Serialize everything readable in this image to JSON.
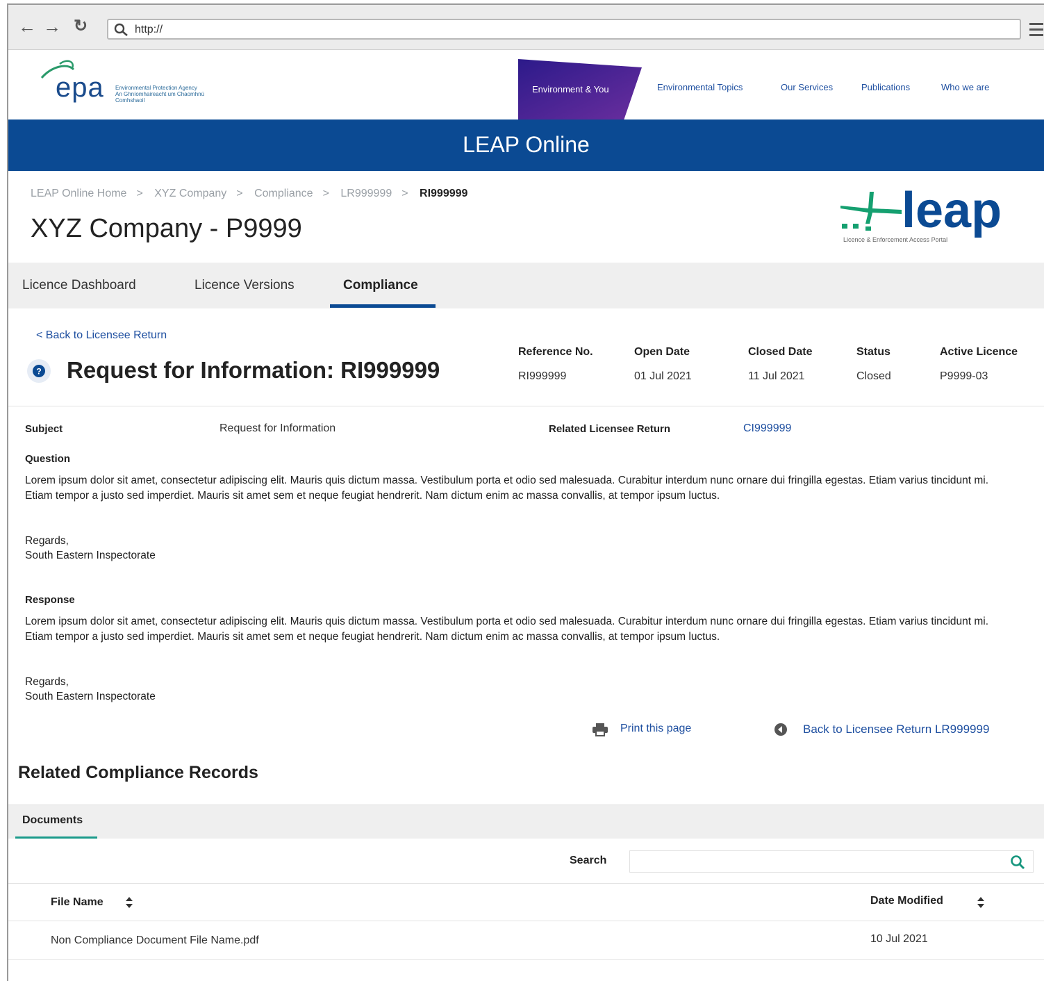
{
  "browser": {
    "url": "http://"
  },
  "header": {
    "logo_text": "epa",
    "logo_tagline_1": "Environmental Protection Agency",
    "logo_tagline_2": "An Ghníomhaireacht um Chaomhnú Comhshaoil",
    "nav": [
      "Environment & You",
      "Environmental Topics",
      "Our Services",
      "Publications",
      "Who we are"
    ],
    "accent_gradient": [
      "#3a1b8c",
      "#5b2a9a"
    ]
  },
  "banner": {
    "title": "LEAP Online",
    "color": "#0b4a93"
  },
  "breadcrumb": [
    "LEAP Online Home",
    "XYZ Company",
    "Compliance",
    "LR999999",
    "RI999999"
  ],
  "page": {
    "company_title": "XYZ Company - P9999",
    "leap_logo_text": "leap",
    "leap_logo_tagline": "Licence & Enforcement Access Portal"
  },
  "tabs": [
    "Licence Dashboard",
    "Licence Versions",
    "Compliance"
  ],
  "rfi": {
    "back_link": "< Back to Licensee Return",
    "title": "Request for Information: RI999999",
    "meta": [
      {
        "label": "Reference No.",
        "value": "RI999999"
      },
      {
        "label": "Open Date",
        "value": "01 Jul 2021"
      },
      {
        "label": "Closed Date",
        "value": "11 Jul 2021"
      },
      {
        "label": "Status",
        "value": "Closed"
      },
      {
        "label": "Active Licence",
        "value": "P9999-03"
      }
    ],
    "subject_label": "Subject",
    "subject_value": "Request for Information",
    "related_label": "Related Licensee Return",
    "related_value": "CI999999",
    "question_label": "Question",
    "question_text": "Lorem ipsum dolor sit amet, consectetur adipiscing elit. Mauris quis dictum massa. Vestibulum porta et odio sed malesuada. Curabitur interdum nunc ornare dui fringilla egestas. Etiam varius tincidunt mi. Etiam tempor a justo sed imperdiet. Mauris sit amet sem et neque feugiat hendrerit. Nam dictum enim ac massa convallis, at tempor ipsum luctus.",
    "question_regards": "Regards,",
    "question_sign": "South Eastern Inspectorate",
    "response_label": "Response",
    "response_text": "Lorem ipsum dolor sit amet, consectetur adipiscing elit. Mauris quis dictum massa. Vestibulum porta et odio sed malesuada. Curabitur interdum nunc ornare dui fringilla egestas. Etiam varius tincidunt mi. Etiam tempor a justo sed imperdiet. Mauris sit amet sem et neque feugiat hendrerit. Nam dictum enim ac massa convallis, at tempor ipsum luctus.",
    "response_regards": "Regards,",
    "response_sign": "South Eastern Inspectorate",
    "print_link": "Print this page",
    "back_return_link": "Back to Licensee Return LR999999"
  },
  "related": {
    "title": "Related Compliance Records",
    "tab": "Documents",
    "search_label": "Search",
    "search_value": "",
    "columns": [
      "File Name",
      "Date Modified"
    ],
    "rows": [
      {
        "file_name": "Non Compliance Document File Name.pdf",
        "date_modified": "10 Jul 2021"
      }
    ]
  }
}
